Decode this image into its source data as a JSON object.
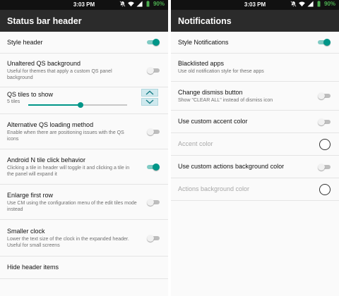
{
  "status_bar": {
    "time": "3:03 PM",
    "battery": "90%"
  },
  "left": {
    "title": "Status bar header",
    "rows": [
      {
        "title": "Style header",
        "sub": "",
        "toggle": true
      },
      {
        "title": "Unaltered QS background",
        "sub": "Useful for themes that apply a custom QS panel background",
        "toggle": false
      },
      {
        "title": "QS tiles to show",
        "value": "5 tiles",
        "slider_level": 0.53
      },
      {
        "title": "Alternative QS loading method",
        "sub": "Enable when there are positioning issues with the QS icons",
        "toggle": false
      },
      {
        "title": "Android N tile click behavior",
        "sub": "Clicking a tile in header will toggle it and clicking a tile in the panel will expand it",
        "toggle": true
      },
      {
        "title": "Enlarge first row",
        "sub": "Use CM using the configuration menu of the edit tiles mode instead",
        "toggle": false
      },
      {
        "title": "Smaller clock",
        "sub": "Lower the text size of the clock in the expanded header. Useful for small screens",
        "toggle": false
      },
      {
        "title": "Hide header items",
        "sub": ""
      }
    ]
  },
  "right": {
    "title": "Notifications",
    "rows": [
      {
        "title": "Style Notifications",
        "sub": "",
        "toggle": true
      },
      {
        "title": "Blacklisted apps",
        "sub": "Use old notification style for these apps"
      },
      {
        "title": "Change dismiss button",
        "sub": "Show \"CLEAR ALL\" instead of dismiss icon",
        "toggle": false
      },
      {
        "title": "Use custom accent color",
        "sub": "",
        "toggle": false
      },
      {
        "title": "Accent color",
        "sub": "",
        "disabled": true
      },
      {
        "title": "Use custom actions background color",
        "sub": "",
        "toggle": false
      },
      {
        "title": "Actions background color",
        "sub": "",
        "disabled": true
      }
    ]
  },
  "colors": {
    "accent": "#009688",
    "appbar": "#2b2b2b",
    "statusbar": "#111111",
    "battery": "#4caf50"
  },
  "icons": {
    "status": [
      "muted-bell-icon",
      "wifi-icon",
      "signal-icon",
      "battery-icon"
    ],
    "stepper": [
      "chevron-up-icon",
      "chevron-down-icon"
    ]
  }
}
